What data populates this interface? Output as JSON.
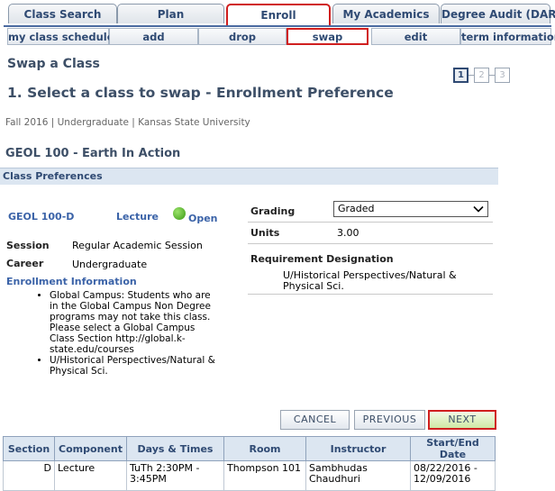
{
  "primary_tabs": [
    {
      "label": "Class Search"
    },
    {
      "label": "Plan"
    },
    {
      "label": "Enroll"
    },
    {
      "label": "My Academics"
    },
    {
      "label": "Degree Audit (DARS)"
    }
  ],
  "secondary_tabs": [
    {
      "label": "my class schedule"
    },
    {
      "label": "add"
    },
    {
      "label": "drop"
    },
    {
      "label": "swap"
    },
    {
      "label": "edit"
    },
    {
      "label": "term information"
    }
  ],
  "page_title": "Swap a Class",
  "steps": [
    "1",
    "2",
    "3"
  ],
  "subtitle": "1.  Select a class to swap - Enrollment Preference",
  "term_info": "Fall 2016 | Undergraduate | Kansas State University",
  "course_title": "GEOL  100 - Earth In Action",
  "preferences_header": "Class Preferences",
  "class_section": "GEOL  100-D",
  "component": "Lecture",
  "status": "Open",
  "session_label": "Session",
  "session_value": "Regular Academic Session",
  "career_label": "Career",
  "career_value": "Undergraduate",
  "enrollment_info_label": "Enrollment Information",
  "enrollment_notes": [
    "Global Campus: Students who are in the Global Campus Non Degree programs may not take this class. Please select a Global Campus Class Section http://global.k-state.edu/courses",
    "U/Historical Perspectives/Natural & Physical Sci."
  ],
  "grading_label": "Grading",
  "grading_value": "Graded",
  "units_label": "Units",
  "units_value": "3.00",
  "requirement_label": "Requirement Designation",
  "requirement_value": "U/Historical Perspectives/Natural & Physical Sci.",
  "buttons": {
    "cancel": "CANCEL",
    "previous": "PREVIOUS",
    "next": "NEXT"
  },
  "table": {
    "headers": [
      "Section",
      "Component",
      "Days & Times",
      "Room",
      "Instructor",
      "Start/End Date"
    ],
    "row": {
      "section": "D",
      "component": "Lecture",
      "days_times": "TuTh 2:30PM - 3:45PM",
      "room": "Thompson 101",
      "instructor": "Sambhudas Chaudhuri",
      "dates": "08/22/2016 - 12/09/2016"
    }
  },
  "colors": {
    "accent": "#2f4a73",
    "link": "#3b63a8",
    "highlight": "#d01f1f",
    "status_open": "#3a9a14"
  }
}
